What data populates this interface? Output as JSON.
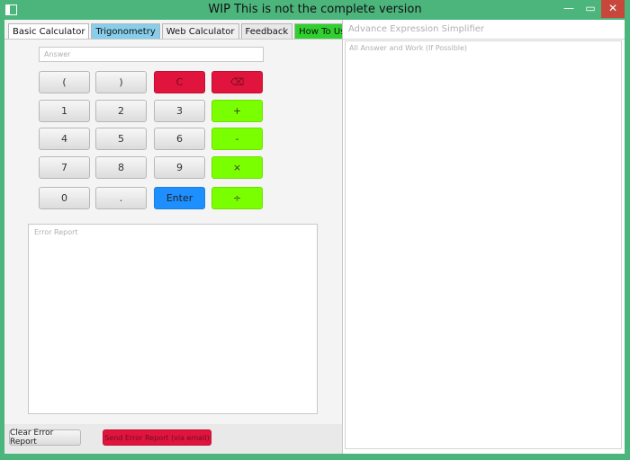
{
  "window": {
    "title": "WIP This is not the complete version",
    "min_icon": "minimize-icon",
    "max_icon": "maximize-icon",
    "close_icon": "close-icon"
  },
  "tabs": [
    {
      "label": "Basic Calculator",
      "active": true
    },
    {
      "label": "Trigonometry",
      "color": "#87ceeb"
    },
    {
      "label": "Web Calculator"
    },
    {
      "label": "Feedback"
    },
    {
      "label": "How To Use",
      "color": "#2fd12f"
    }
  ],
  "calculator": {
    "answer_placeholder": "Answer",
    "buttons": {
      "open_paren": "(",
      "close_paren": ")",
      "clear": "C",
      "backspace": "⌫",
      "one": "1",
      "two": "2",
      "three": "3",
      "plus": "+",
      "four": "4",
      "five": "5",
      "six": "6",
      "minus": "-",
      "seven": "7",
      "eight": "8",
      "nine": "9",
      "multiply": "×",
      "zero": "0",
      "dot": ".",
      "enter": "Enter",
      "divide": "÷"
    },
    "error_report_placeholder": "Error Report",
    "clear_error_label": "Clear Error Report",
    "send_error_label": "Send Error Report (via email)"
  },
  "simplifier": {
    "title_placeholder": "Advance Expression Simplifier",
    "work_placeholder": "All Answer and Work (If Possible)"
  },
  "colors": {
    "red": "#e0143c",
    "green": "#7aff00",
    "blue": "#1e8fff",
    "window": "#4cb57c"
  }
}
